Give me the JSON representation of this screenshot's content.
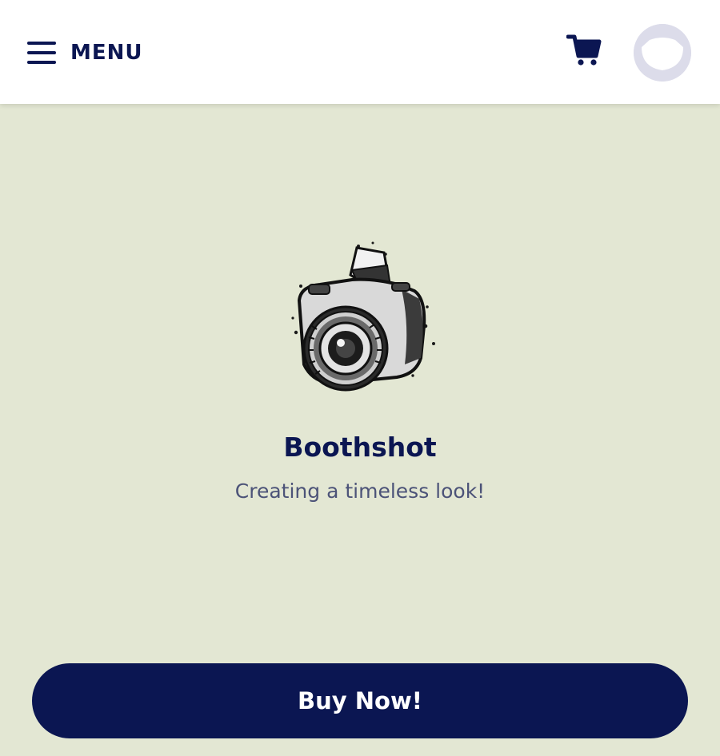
{
  "header": {
    "menu_label": "MENU",
    "icons": {
      "menu": "hamburger-icon",
      "cart": "shopping-cart-icon",
      "avatar": "cat-avatar-icon"
    }
  },
  "product": {
    "image_icon": "camera-icon",
    "title": "Boothshot",
    "tagline": "Creating a timeless look!"
  },
  "cta": {
    "label": "Buy Now!"
  },
  "colors": {
    "background": "#e3e7d3",
    "header_background": "#ffffff",
    "brand_navy": "#0b1652",
    "tagline_text": "#4c5378",
    "avatar_background": "#dcdcea",
    "button_text": "#ffffff"
  }
}
